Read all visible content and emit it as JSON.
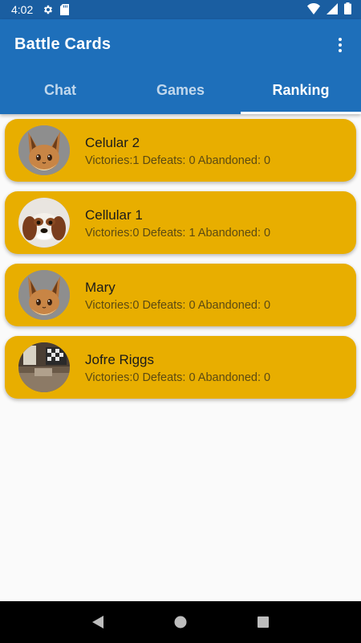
{
  "status_bar": {
    "time": "4:02",
    "icons": [
      "gear-icon",
      "sd-card-icon",
      "wifi-icon",
      "signal-icon",
      "battery-icon"
    ]
  },
  "app_bar": {
    "title": "Battle Cards",
    "overflow_icon": "more-vert-icon",
    "tabs": [
      {
        "label": "Chat",
        "active": false
      },
      {
        "label": "Games",
        "active": false
      },
      {
        "label": "Ranking",
        "active": true
      }
    ]
  },
  "ranking": {
    "items": [
      {
        "name": "Celular 2",
        "stats": "Victories:1 Defeats: 0 Abandoned: 0",
        "avatar": "eevee-avatar-icon"
      },
      {
        "name": "Cellular 1",
        "stats": "Victories:0 Defeats: 1 Abandoned: 0",
        "avatar": "dog-avatar-icon"
      },
      {
        "name": "Mary",
        "stats": "Victories:0 Defeats: 0 Abandoned: 0",
        "avatar": "eevee-avatar-icon"
      },
      {
        "name": "Jofre Riggs",
        "stats": "Victories:0 Defeats: 0 Abandoned: 0",
        "avatar": "room-photo-avatar-icon"
      }
    ]
  },
  "colors": {
    "status_bar": "#1a5ea1",
    "app_bar": "#1e6fba",
    "card": "#e8ae00",
    "background": "#fafafa"
  },
  "nav_bar": {
    "buttons": [
      "back-icon",
      "home-icon",
      "recents-icon"
    ]
  }
}
